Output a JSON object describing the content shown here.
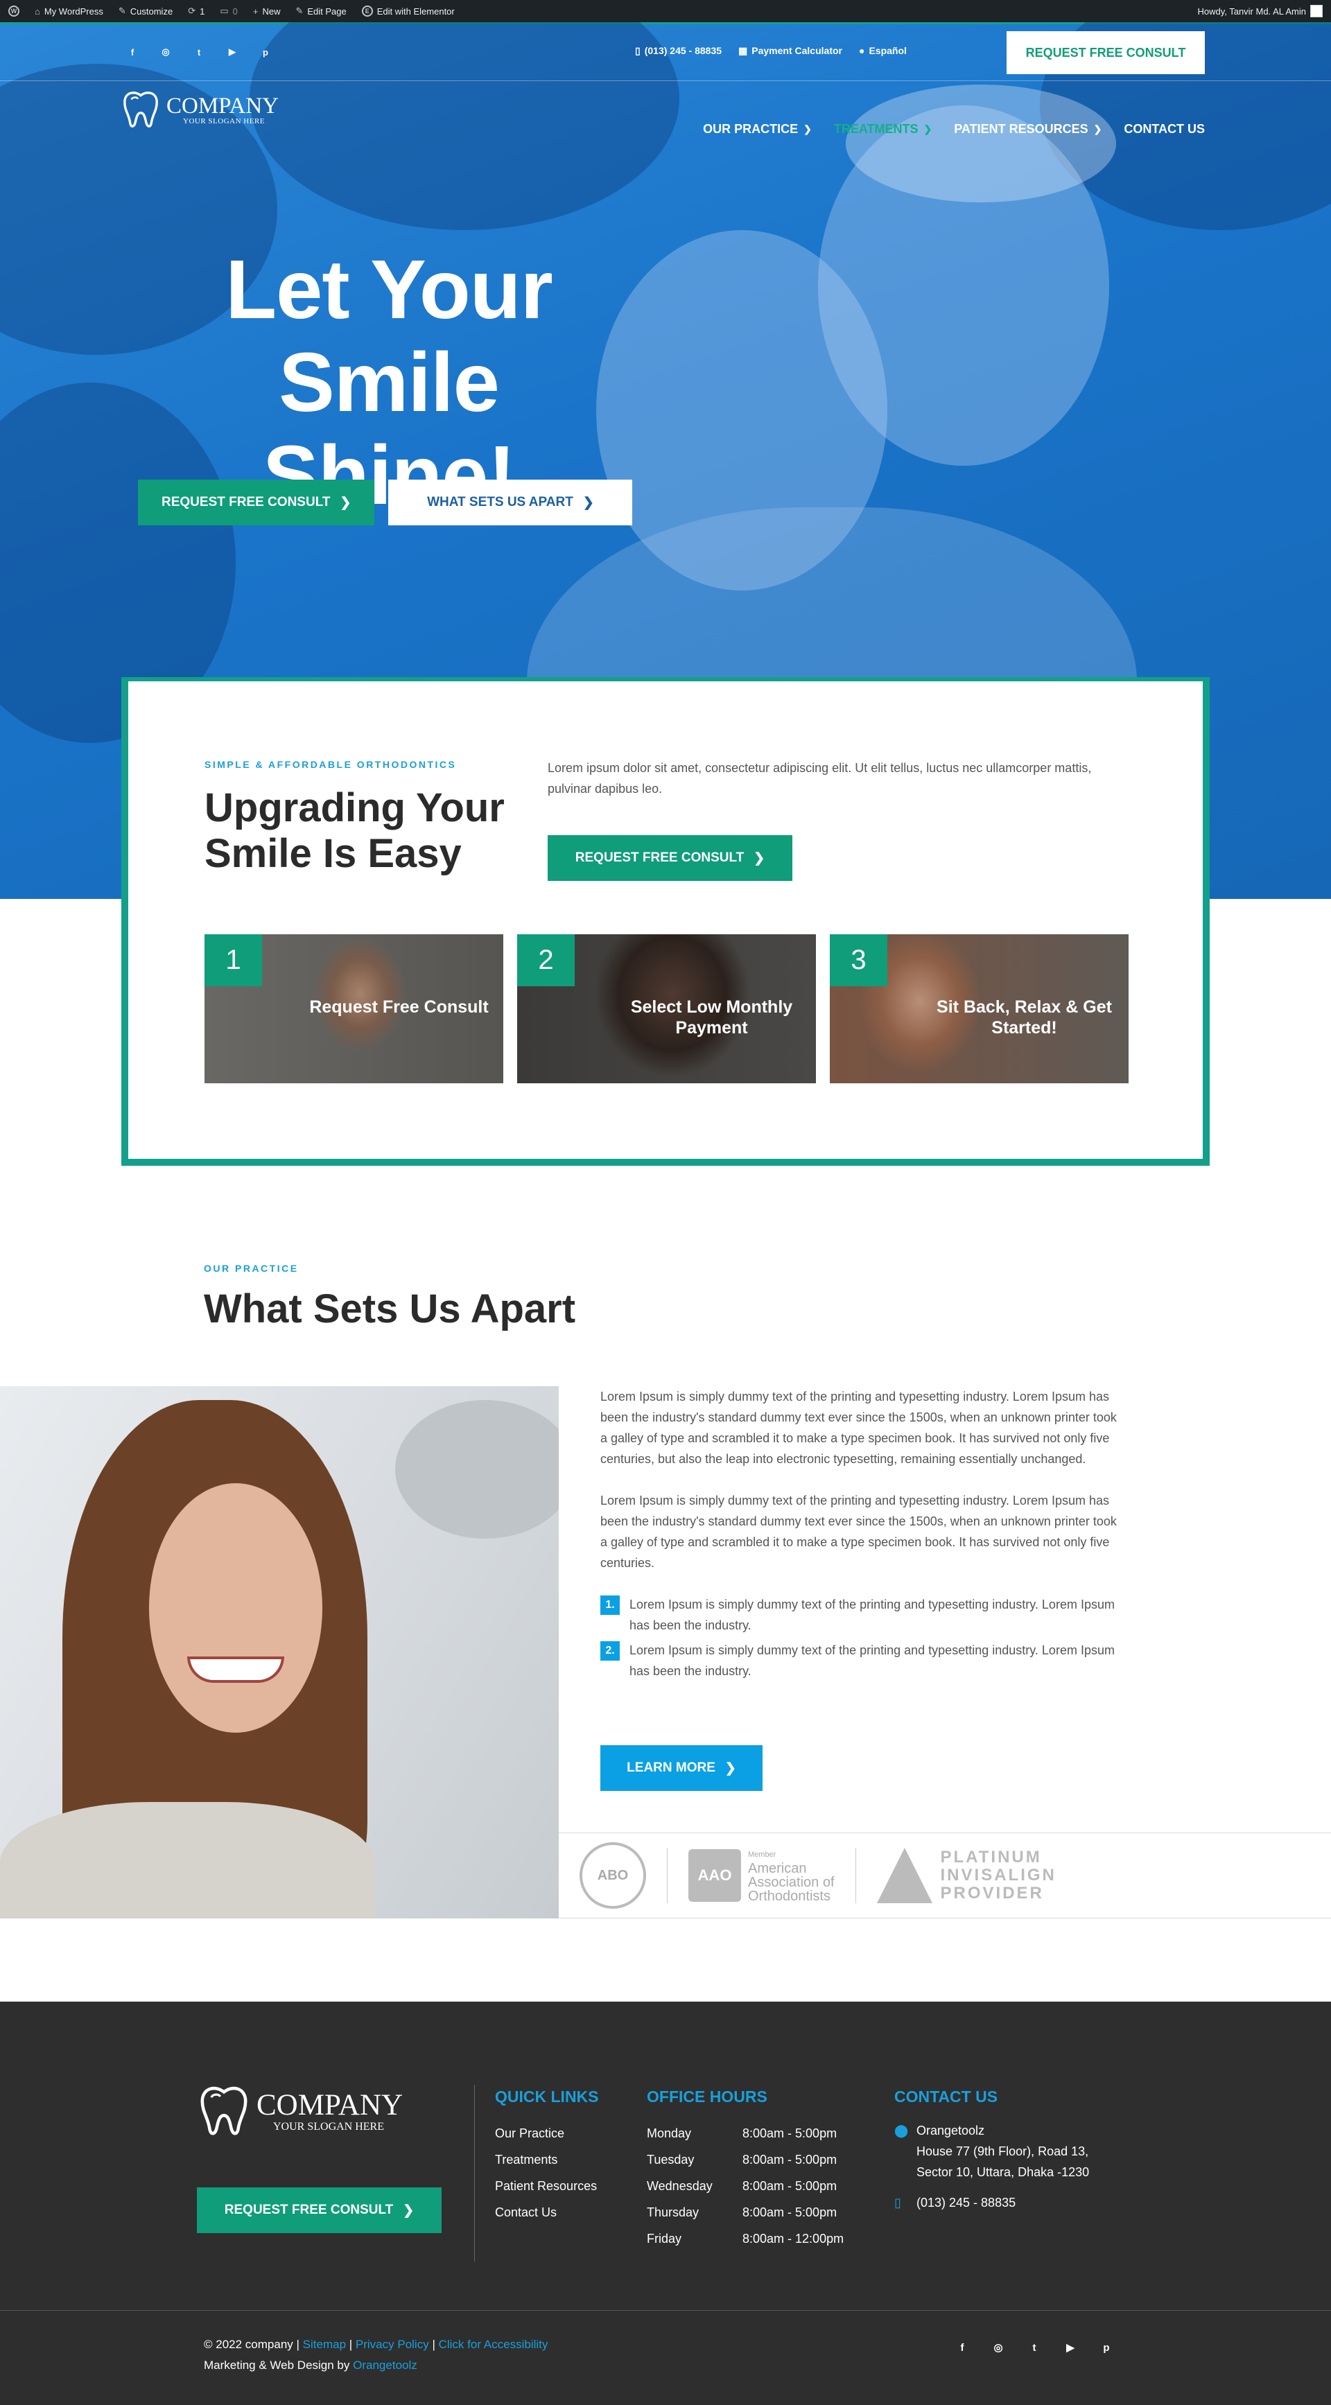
{
  "admin_bar": {
    "site": "My WordPress",
    "customize": "Customize",
    "updates": "1",
    "comments": "0",
    "new": "New",
    "edit_page": "Edit Page",
    "elementor": "Edit with Elementor",
    "greeting": "Howdy, Tanvir Md. AL Amin"
  },
  "topbar": {
    "socials": [
      "facebook-icon",
      "instagram-icon",
      "twitter-icon",
      "youtube-icon",
      "pinterest-icon"
    ],
    "phone": "(013) 245 - 88835",
    "calculator": "Payment Calculator",
    "language": "Español",
    "cta": "REQUEST FREE CONSULT"
  },
  "logo": {
    "name": "COMPANY",
    "slogan": "YOUR SLOGAN HERE"
  },
  "nav": {
    "items": [
      {
        "label": "OUR PRACTICE",
        "dropdown": true
      },
      {
        "label": "TREATMENTS",
        "dropdown": true,
        "active": true
      },
      {
        "label": "PATIENT RESOURCES",
        "dropdown": true
      },
      {
        "label": "CONTACT US",
        "dropdown": false
      }
    ]
  },
  "hero": {
    "title_line1": "Let Your",
    "title_line2": "Smile Shine!",
    "primary_cta": "REQUEST FREE CONSULT",
    "secondary_cta": "WHAT SETS US APART"
  },
  "steps_section": {
    "eyebrow": "SIMPLE & AFFORDABLE ORTHODONTICS",
    "title_line1": "Upgrading Your",
    "title_line2": "Smile Is Easy",
    "intro": "Lorem ipsum dolor sit amet, consectetur adipiscing elit. Ut elit tellus, luctus nec ullamcorper mattis, pulvinar dapibus leo.",
    "cta": "REQUEST FREE CONSULT",
    "steps": [
      {
        "num": "1",
        "label": "Request Free Consult"
      },
      {
        "num": "2",
        "label": "Select Low Monthly Payment"
      },
      {
        "num": "3",
        "label": "Sit Back, Relax & Get Started!"
      }
    ]
  },
  "apart": {
    "eyebrow": "OUR PRACTICE",
    "title": "What Sets Us Apart",
    "p1": "Lorem Ipsum is simply dummy text of the printing and typesetting industry. Lorem Ipsum has been the industry's standard dummy text ever since the 1500s, when an unknown printer took a galley of type and scrambled it to make a type specimen book. It has survived not only five centuries, but also the leap into electronic typesetting, remaining essentially unchanged.",
    "p2": "Lorem Ipsum is simply dummy text of the printing and typesetting industry. Lorem Ipsum has been the industry's standard dummy text ever since the 1500s, when an unknown printer took a galley of type and scrambled it to make a type specimen book. It has survived not only five centuries.",
    "list": [
      {
        "n": "1.",
        "text": "Lorem Ipsum is simply dummy text of the printing and typesetting industry. Lorem Ipsum has been the industry."
      },
      {
        "n": "2.",
        "text": "Lorem Ipsum is simply dummy text of the printing and typesetting industry. Lorem Ipsum has been the industry."
      }
    ],
    "cta": "LEARN MORE",
    "badges": {
      "abo": "ABO",
      "aao_box": "AAO",
      "aao_member": "Member",
      "aao_line1": "American",
      "aao_line2": "Association of",
      "aao_line3": "Orthodontists",
      "inv_line1": "PLATINUM",
      "inv_line2": "INVISALIGN",
      "inv_line3": "PROVIDER"
    }
  },
  "footer": {
    "logo_name": "COMPANY",
    "logo_slogan": "YOUR SLOGAN HERE",
    "cta": "REQUEST FREE CONSULT",
    "quick_links_title": "QUICK LINKS",
    "quick_links": [
      "Our Practice",
      "Treatments",
      "Patient Resources",
      "Contact Us"
    ],
    "hours_title": "OFFICE HOURS",
    "hours": [
      {
        "day": "Monday",
        "time": "8:00am - 5:00pm"
      },
      {
        "day": "Tuesday",
        "time": "8:00am - 5:00pm"
      },
      {
        "day": "Wednesday",
        "time": "8:00am - 5:00pm"
      },
      {
        "day": "Thursday",
        "time": "8:00am - 5:00pm"
      },
      {
        "day": "Friday",
        "time": "8:00am - 12:00pm"
      }
    ],
    "contact_title": "CONTACT US",
    "contact_name": "Orangetoolz",
    "address_line1": "House 77 (9th Floor), Road 13,",
    "address_line2": "Sector 10, Uttara, Dhaka -1230",
    "phone": "(013) 245 - 88835",
    "copyright": "© 2022 company |",
    "sitemap": "Sitemap",
    "privacy": "Privacy Policy",
    "accessibility": "Click for Accessibility",
    "credit_prefix": "Marketing & Web Design by",
    "credit_link": "Orangetoolz"
  },
  "colors": {
    "brand_blue": "#1a74c9",
    "brand_green": "#0f9d7a",
    "accent_cyan": "#0ba0e3",
    "footer_bg": "#2e2e2e"
  }
}
